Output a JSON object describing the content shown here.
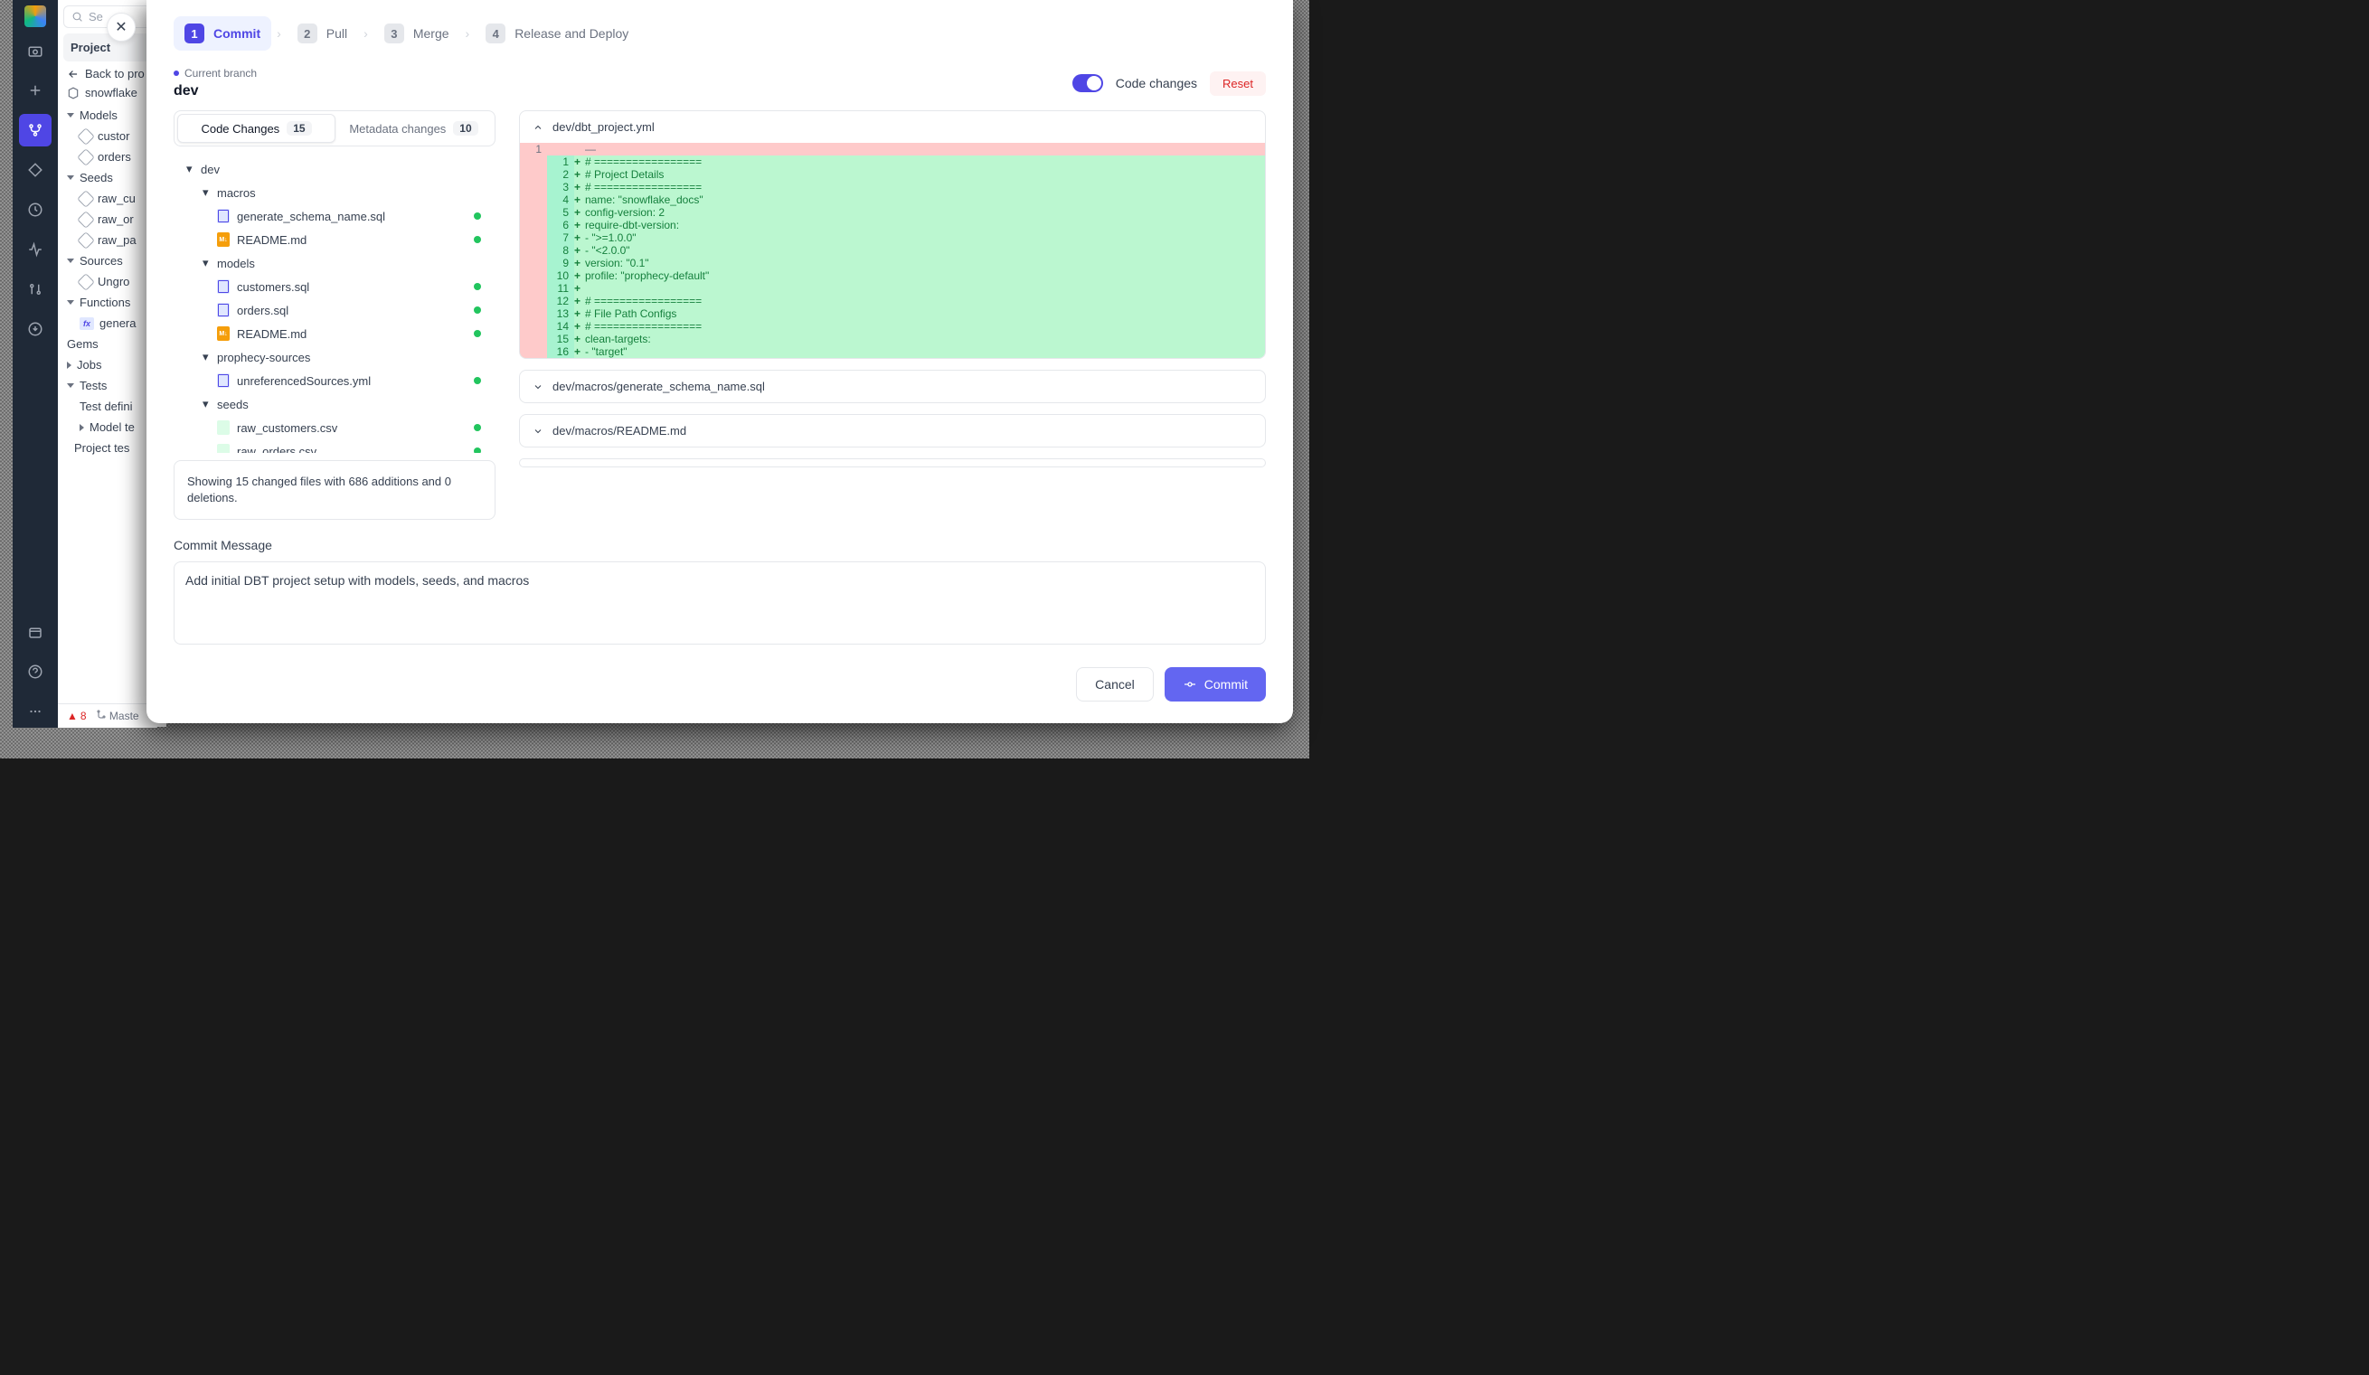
{
  "search_placeholder": "Se",
  "project_header": "Project",
  "back_link": "Back to pro",
  "project_name": "snowflake",
  "sidebar_tree": {
    "models": "Models",
    "customers": "custor",
    "orders": "orders",
    "seeds": "Seeds",
    "raw_cu": "raw_cu",
    "raw_or": "raw_or",
    "raw_pa": "raw_pa",
    "sources": "Sources",
    "ungro": "Ungro",
    "functions": "Functions",
    "genera": "genera",
    "gems": "Gems",
    "jobs": "Jobs",
    "tests": "Tests",
    "test_def": "Test defini",
    "model_te": "Model te",
    "project_te": "Project tes"
  },
  "status": {
    "err_count": "8",
    "master": "Maste"
  },
  "stepper": [
    {
      "num": "1",
      "label": "Commit"
    },
    {
      "num": "2",
      "label": "Pull"
    },
    {
      "num": "3",
      "label": "Merge"
    },
    {
      "num": "4",
      "label": "Release and Deploy"
    }
  ],
  "branch": {
    "label": "Current branch",
    "name": "dev"
  },
  "toggle_label": "Code changes",
  "reset_label": "Reset",
  "tabs": {
    "code": "Code Changes",
    "code_count": "15",
    "meta": "Metadata changes",
    "meta_count": "10"
  },
  "tree": {
    "dev": "dev",
    "macros": "macros",
    "gen_schema": "generate_schema_name.sql",
    "readme1": "README.md",
    "models": "models",
    "customers_sql": "customers.sql",
    "orders_sql": "orders.sql",
    "readme2": "README.md",
    "prophecy_sources": "prophecy-sources",
    "unref": "unreferencedSources.yml",
    "seeds": "seeds",
    "raw_customers": "raw_customers.csv",
    "raw_orders": "raw_orders.csv"
  },
  "summary": "Showing 15 changed files with 686 additions and 0 deletions.",
  "diffs": {
    "f1": "dev/dbt_project.yml",
    "f2": "dev/macros/generate_schema_name.sql",
    "f3": "dev/macros/README.md",
    "lines": [
      {
        "l1": "1",
        "l2": "",
        "sign": "",
        "code": "—"
      },
      {
        "l1": "",
        "l2": "1",
        "sign": "+",
        "code": "# ================="
      },
      {
        "l1": "",
        "l2": "2",
        "sign": "+",
        "code": "# Project Details"
      },
      {
        "l1": "",
        "l2": "3",
        "sign": "+",
        "code": "# ================="
      },
      {
        "l1": "",
        "l2": "4",
        "sign": "+",
        "code": "name: \"snowflake_docs\""
      },
      {
        "l1": "",
        "l2": "5",
        "sign": "+",
        "code": "config-version: 2"
      },
      {
        "l1": "",
        "l2": "6",
        "sign": "+",
        "code": "require-dbt-version:"
      },
      {
        "l1": "",
        "l2": "7",
        "sign": "+",
        "code": "- \">=1.0.0\""
      },
      {
        "l1": "",
        "l2": "8",
        "sign": "+",
        "code": "- \"<2.0.0\""
      },
      {
        "l1": "",
        "l2": "9",
        "sign": "+",
        "code": "version: \"0.1\""
      },
      {
        "l1": "",
        "l2": "10",
        "sign": "+",
        "code": "profile: \"prophecy-default\""
      },
      {
        "l1": "",
        "l2": "11",
        "sign": "+",
        "code": ""
      },
      {
        "l1": "",
        "l2": "12",
        "sign": "+",
        "code": "# ================="
      },
      {
        "l1": "",
        "l2": "13",
        "sign": "+",
        "code": "# File Path Configs"
      },
      {
        "l1": "",
        "l2": "14",
        "sign": "+",
        "code": "# ================="
      },
      {
        "l1": "",
        "l2": "15",
        "sign": "+",
        "code": "clean-targets:"
      },
      {
        "l1": "",
        "l2": "16",
        "sign": "+",
        "code": "- \"target\""
      }
    ]
  },
  "commit": {
    "label": "Commit Message",
    "value": "Add initial DBT project setup with models, seeds, and macros"
  },
  "footer": {
    "cancel": "Cancel",
    "commit": "Commit"
  }
}
